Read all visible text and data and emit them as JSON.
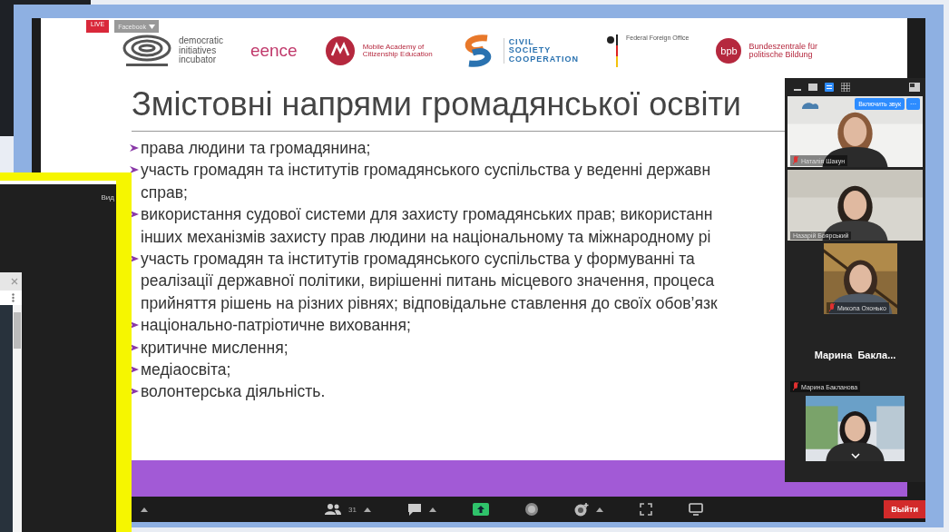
{
  "meeting": {
    "live_badge": "LIVE",
    "stream_menu": "Facebook",
    "slide": {
      "logos": [
        {
          "kind": "dii",
          "lines": [
            "democratic",
            "initiatives",
            "incubator"
          ]
        },
        {
          "kind": "eence",
          "lines": [
            "eence"
          ]
        },
        {
          "kind": "mace",
          "lines": [
            "Mobile Academy of",
            "Citizenship Education"
          ]
        },
        {
          "kind": "csc",
          "lines": [
            "CIVIL",
            "SOCIETY",
            "COOPERATION"
          ]
        },
        {
          "kind": "ffo",
          "lines": [
            "Federal Foreign Office"
          ]
        },
        {
          "kind": "bpb",
          "mark": "bpb",
          "lines": [
            "Bundeszentrale für",
            "politische Bildung"
          ]
        }
      ],
      "title": "Змістовні напрями громадянської освіти",
      "bullets": [
        {
          "lines": [
            "права людини та громадянина;"
          ]
        },
        {
          "lines": [
            "участь громадян та інститутів громадянського суспільства у веденні державн",
            "справ;"
          ]
        },
        {
          "lines": [
            "використання судової системи для захисту громадянських прав; використанн",
            "інших механізмів захисту прав людини на національному та міжнародному рі"
          ]
        },
        {
          "lines": [
            "участь громадян та інститутів громадянського суспільства у формуванні та",
            "реалізації державної політики, вирішенні питань місцевого значення, процеса",
            "прийняття рішень на різних рівнях; відповідальне ставлення до своїх обов’язк"
          ]
        },
        {
          "lines": [
            "національно-патріотичне виховання;"
          ]
        },
        {
          "lines": [
            "критичне мислення;"
          ]
        },
        {
          "lines": [
            "медіаосвіта;"
          ]
        },
        {
          "lines": [
            "волонтерська діяльність."
          ]
        }
      ]
    },
    "video_panel": {
      "unmute_button": "Включить звук",
      "more_button": "···",
      "tiles": [
        {
          "kind": "video",
          "name": "Наталія Шакун",
          "muted": true
        },
        {
          "kind": "video",
          "name": "Назарій Боярський",
          "muted": false
        },
        {
          "kind": "video",
          "name": "Микола Охонько",
          "muted": true
        },
        {
          "kind": "name_only",
          "display": "Марина  Бакла...",
          "name": "Марина Бакланова",
          "muted": true
        },
        {
          "kind": "video"
        }
      ]
    },
    "toolbar": {
      "participants_count": "31",
      "leave_button": "Выйти"
    }
  },
  "overlay_window": {
    "view_label": "Вид"
  }
}
